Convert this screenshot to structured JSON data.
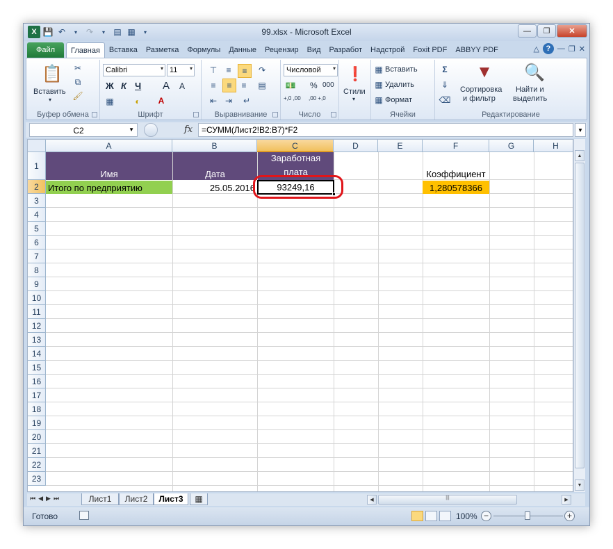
{
  "window": {
    "title": "99.xlsx - Microsoft Excel",
    "logo": "X"
  },
  "ribbon_tabs": [
    "Файл",
    "Главная",
    "Вставка",
    "Разметка",
    "Формулы",
    "Данные",
    "Рецензир",
    "Вид",
    "Разработ",
    "Надстрой",
    "Foxit PDF",
    "ABBYY PDF"
  ],
  "active_tab": "Главная",
  "ribbon": {
    "clipboard": {
      "label": "Буфер обмена",
      "paste": "Вставить"
    },
    "font": {
      "label": "Шрифт",
      "name": "Calibri",
      "size": "11",
      "bold": "Ж",
      "italic": "К",
      "underline": "Ч",
      "grow": "A",
      "shrink": "A"
    },
    "alignment": {
      "label": "Выравнивание"
    },
    "number": {
      "label": "Число",
      "format": "Числовой",
      "percent": "%",
      "thousands": "000",
      "inc": "+,0 ,00",
      "dec": ",00 +,0"
    },
    "styles": {
      "label": "Стили"
    },
    "cells": {
      "label": "Ячейки",
      "insert": "Вставить",
      "delete": "Удалить",
      "format": "Формат"
    },
    "editing": {
      "label": "Редактирование",
      "sort": "Сортировка",
      "sort2": "и фильтр",
      "find": "Найти и",
      "find2": "выделить"
    }
  },
  "formula_bar": {
    "name_box": "C2",
    "fx": "fx",
    "formula": "=СУММ(Лист2!B2:B7)*F2"
  },
  "columns": [
    "A",
    "B",
    "C",
    "D",
    "E",
    "F",
    "G",
    "H"
  ],
  "selected_column": "C",
  "rows": [
    "1",
    "2",
    "3",
    "4",
    "5",
    "6",
    "7",
    "8",
    "9",
    "10",
    "11",
    "12",
    "13",
    "14",
    "15",
    "16",
    "17",
    "18",
    "19",
    "20",
    "21",
    "22",
    "23"
  ],
  "selected_row": "2",
  "cells": {
    "A1": "Имя",
    "B1": "Дата",
    "C1_line1": "Заработная",
    "C1_line2": "плата",
    "F1": "Коэффициент",
    "A2": "Итого по предприятию",
    "B2": "25.05.2016",
    "C2": "93249,16",
    "F2": "1,280578366"
  },
  "colors": {
    "header_fill": "#604a7b",
    "total_fill": "#92d050",
    "coef_fill": "#ffc000",
    "highlight_ring": "#e0151a"
  },
  "sheets": [
    "Лист1",
    "Лист2",
    "Лист3"
  ],
  "active_sheet": "Лист3",
  "status": {
    "ready": "Готово",
    "zoom": "100%",
    "zoom_minus": "−",
    "zoom_plus": "+"
  }
}
